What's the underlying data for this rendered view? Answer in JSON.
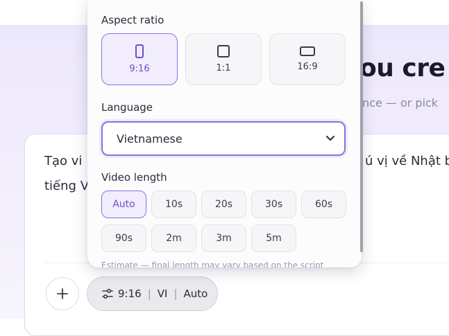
{
  "hero": {
    "title": "ou cre",
    "subtitle": "nce — or pick"
  },
  "composer": {
    "line1": "Tạo vi",
    "line1_tail": "ú vị về Nhật b",
    "line2": "tiếng V"
  },
  "settings_pill": {
    "aspect": "9:16",
    "separator": "|",
    "language": "VI",
    "length": "Auto"
  },
  "popover": {
    "aspect_label": "Aspect ratio",
    "aspect_options": [
      "9:16",
      "1:1",
      "16:9"
    ],
    "aspect_selected": "9:16",
    "language_label": "Language",
    "language_value": "Vietnamese",
    "length_label": "Video length",
    "length_options": [
      "Auto",
      "10s",
      "20s",
      "30s",
      "60s",
      "90s",
      "2m",
      "3m",
      "5m"
    ],
    "length_selected": "Auto",
    "estimate_note": "Estimate — final length may vary based on the script"
  },
  "colors": {
    "accent": "#8b6fe0",
    "accent_text": "#6a4fd0",
    "hero_bg": "#ece7fb"
  }
}
